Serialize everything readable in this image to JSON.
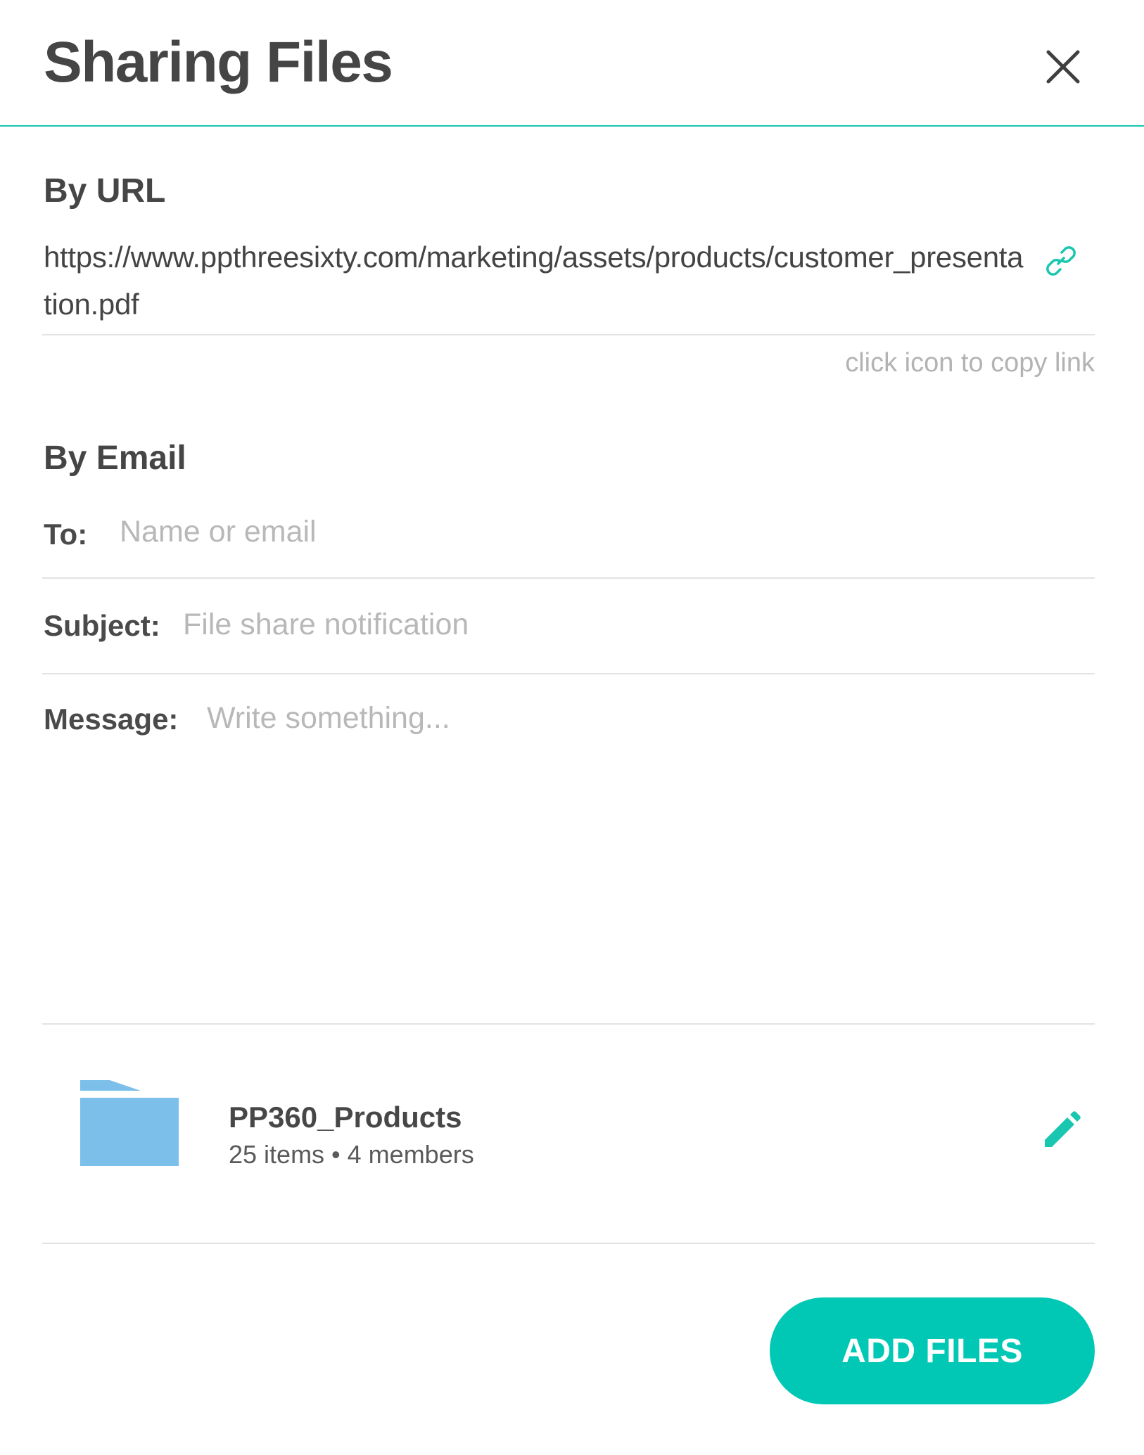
{
  "dialog": {
    "title": "Sharing Files",
    "close_icon": "close-icon"
  },
  "by_url": {
    "heading": "By URL",
    "url": "https://www.ppthreesixty.com/marketing/assets/products/customer_presentation.pdf",
    "copy_icon": "link-icon",
    "hint": "click icon to copy link"
  },
  "by_email": {
    "heading": "By Email",
    "to": {
      "label": "To:",
      "value": "",
      "placeholder": "Name or email"
    },
    "subject": {
      "label": "Subject:",
      "value": "",
      "placeholder": "File share notification"
    },
    "message": {
      "label": "Message:",
      "value": "",
      "placeholder": "Write something..."
    }
  },
  "attachment": {
    "icon": "folder-icon",
    "name": "PP360_Products",
    "meta": "25 items • 4 members",
    "edit_icon": "pencil-icon"
  },
  "actions": {
    "add_files_label": "ADD FILES"
  },
  "colors": {
    "accent": "#00c8b5",
    "folder": "#7bbfea",
    "text": "#474747",
    "placeholder": "#b8b8b8",
    "divider": "#e3e3e3"
  }
}
